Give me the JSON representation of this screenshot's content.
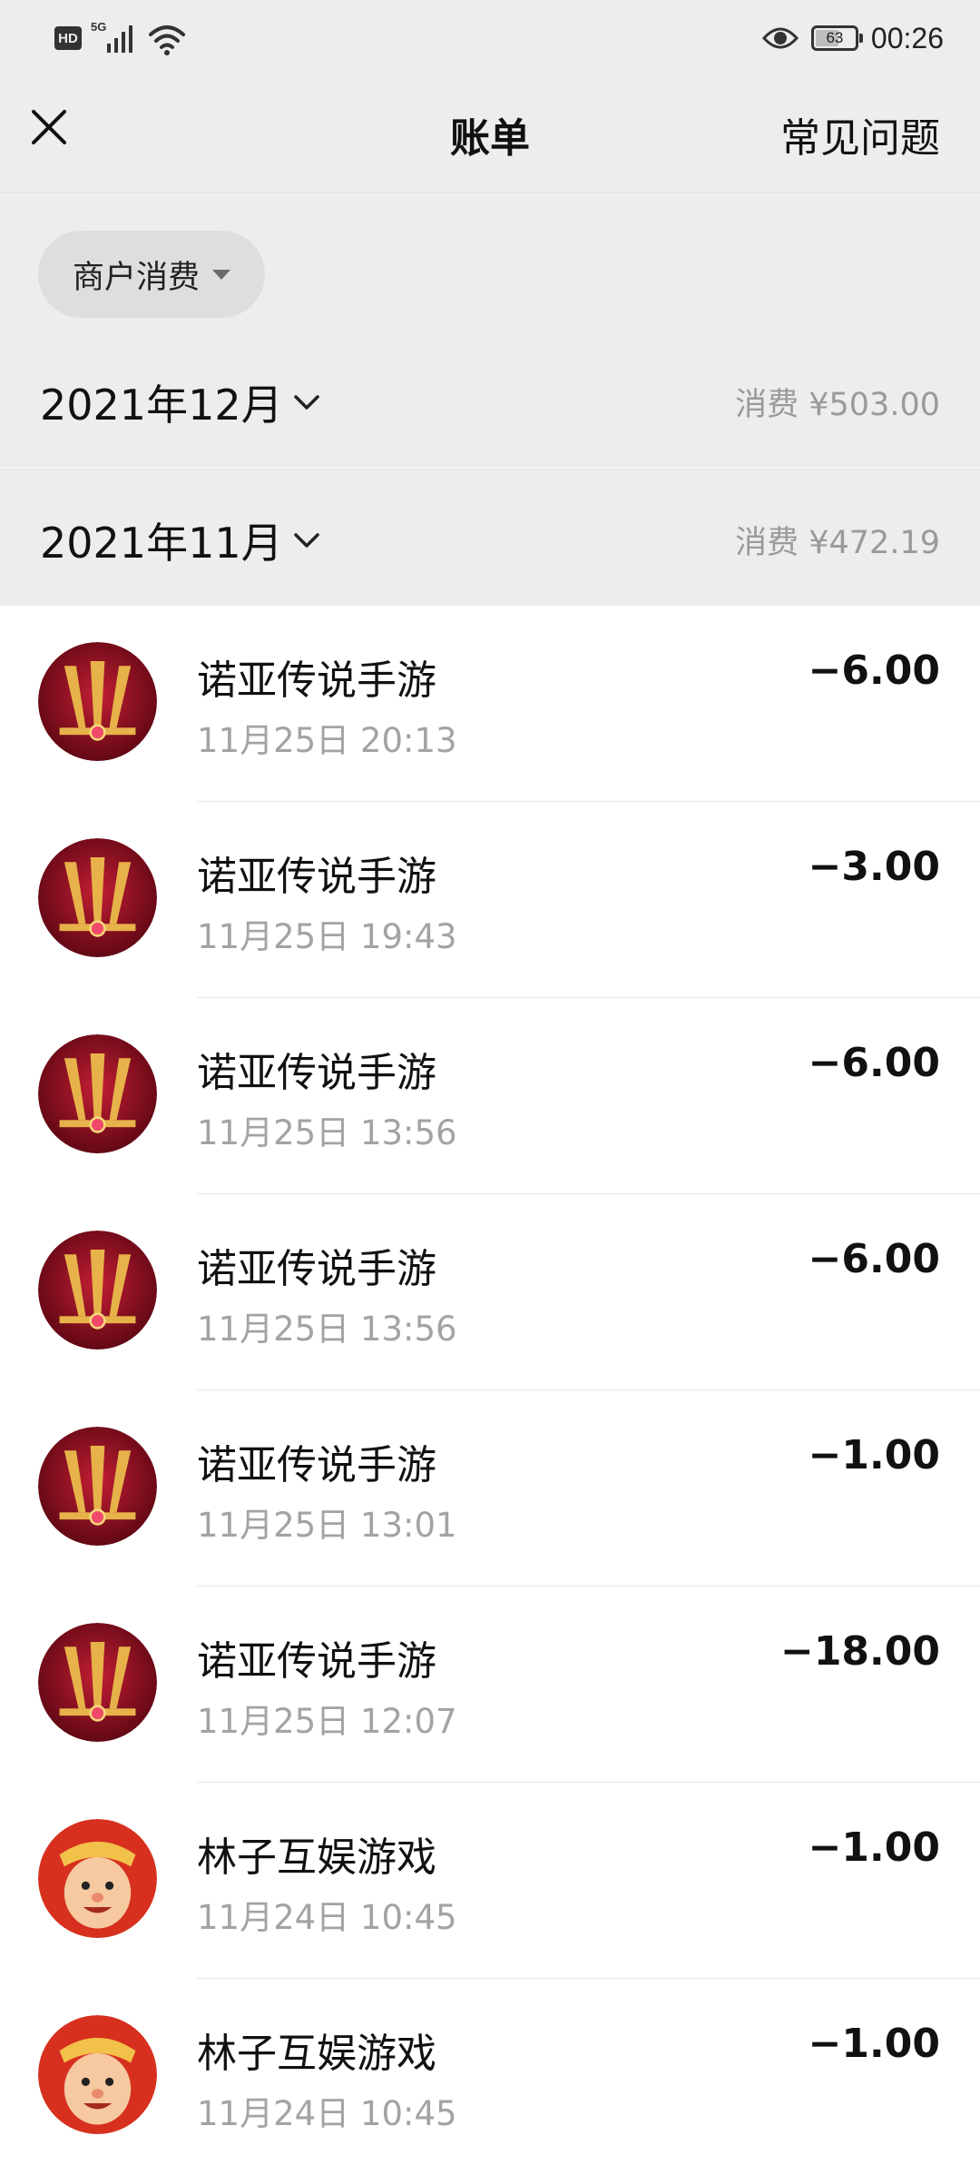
{
  "status_bar": {
    "network_badge": "HD",
    "network_type": "5G",
    "battery": "63",
    "battery_level": 0.63,
    "time": "00:26",
    "icons": [
      "signal-icon",
      "wifi-icon",
      "eye-icon",
      "battery-icon"
    ]
  },
  "nav": {
    "close_icon": "close-icon",
    "title": "账单",
    "faq_label": "常见问题"
  },
  "filter": {
    "selected": "商户消费"
  },
  "months": [
    {
      "label": "2021年12月",
      "summary": "消费 ¥503.00"
    },
    {
      "label": "2021年11月",
      "summary": "消费 ¥472.19"
    }
  ],
  "transactions": [
    {
      "merchant": "诺亚传说手游",
      "time": "11月25日 20:13",
      "amount": "−6.00",
      "avatar": "noah-legend-game-logo"
    },
    {
      "merchant": "诺亚传说手游",
      "time": "11月25日 19:43",
      "amount": "−3.00",
      "avatar": "noah-legend-game-logo"
    },
    {
      "merchant": "诺亚传说手游",
      "time": "11月25日 13:56",
      "amount": "−6.00",
      "avatar": "noah-legend-game-logo"
    },
    {
      "merchant": "诺亚传说手游",
      "time": "11月25日 13:56",
      "amount": "−6.00",
      "avatar": "noah-legend-game-logo"
    },
    {
      "merchant": "诺亚传说手游",
      "time": "11月25日 13:01",
      "amount": "−1.00",
      "avatar": "noah-legend-game-logo"
    },
    {
      "merchant": "诺亚传说手游",
      "time": "11月25日 12:07",
      "amount": "−18.00",
      "avatar": "noah-legend-game-logo"
    },
    {
      "merchant": "林子互娱游戏",
      "time": "11月24日 10:45",
      "amount": "−1.00",
      "avatar": "linzi-game-cartoon-logo"
    },
    {
      "merchant": "林子互娱游戏",
      "time": "11月24日 10:45",
      "amount": "−1.00",
      "avatar": "linzi-game-cartoon-logo"
    }
  ],
  "colors": {
    "header_bg": "#ededed",
    "list_bg": "#ffffff",
    "secondary_text": "#a3a3a3",
    "noah_logo_bg": "#8e0f1c",
    "noah_logo_gold": "#e7b24a",
    "linzi_logo_bg": "#d7301f"
  }
}
